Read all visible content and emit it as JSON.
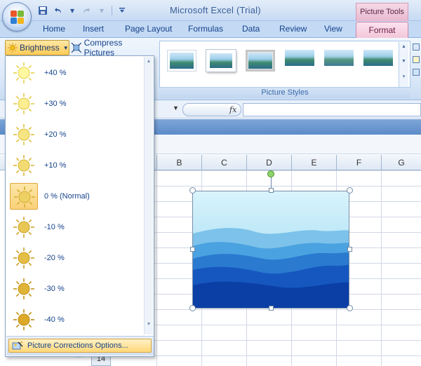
{
  "window": {
    "title": "Microsoft Excel (Trial)",
    "contextual_group": "Picture Tools"
  },
  "quick_access": {
    "save": "save-icon",
    "undo": "undo-icon",
    "redo": "redo-icon",
    "customize": "dropdown-icon"
  },
  "tabs": [
    {
      "label": "Home"
    },
    {
      "label": "Insert"
    },
    {
      "label": "Page Layout"
    },
    {
      "label": "Formulas"
    },
    {
      "label": "Data"
    },
    {
      "label": "Review"
    },
    {
      "label": "View"
    }
  ],
  "active_tab": {
    "label": "Format"
  },
  "ribbon": {
    "brightness_label": "Brightness",
    "compress_label": "Compress Pictures",
    "styles_group_label": "Picture Styles",
    "style_thumb_count_visible": 6
  },
  "formula_bar": {
    "fx_label": "fx",
    "value": ""
  },
  "columns": [
    "B",
    "C",
    "D",
    "E",
    "F",
    "G"
  ],
  "brightness_menu": {
    "items": [
      {
        "label": "+40 %",
        "level": 40,
        "selected": false
      },
      {
        "label": "+30 %",
        "level": 30,
        "selected": false
      },
      {
        "label": "+20 %",
        "level": 20,
        "selected": false
      },
      {
        "label": "+10 %",
        "level": 10,
        "selected": false
      },
      {
        "label": "0 % (Normal)",
        "level": 0,
        "selected": true
      },
      {
        "label": "-10 %",
        "level": -10,
        "selected": false
      },
      {
        "label": "-20 %",
        "level": -20,
        "selected": false
      },
      {
        "label": "-30 %",
        "level": -30,
        "selected": false
      },
      {
        "label": "-40 %",
        "level": -40,
        "selected": false
      }
    ],
    "options_label": "Picture Corrections Options...",
    "grip": "...."
  },
  "row_header_visible": "14",
  "colors": {
    "ribbon_blue": "#c3d9f4",
    "format_tab_pink": "#f3c7da",
    "highlight_gold": "#ffd879",
    "text_blue": "#15428b"
  }
}
